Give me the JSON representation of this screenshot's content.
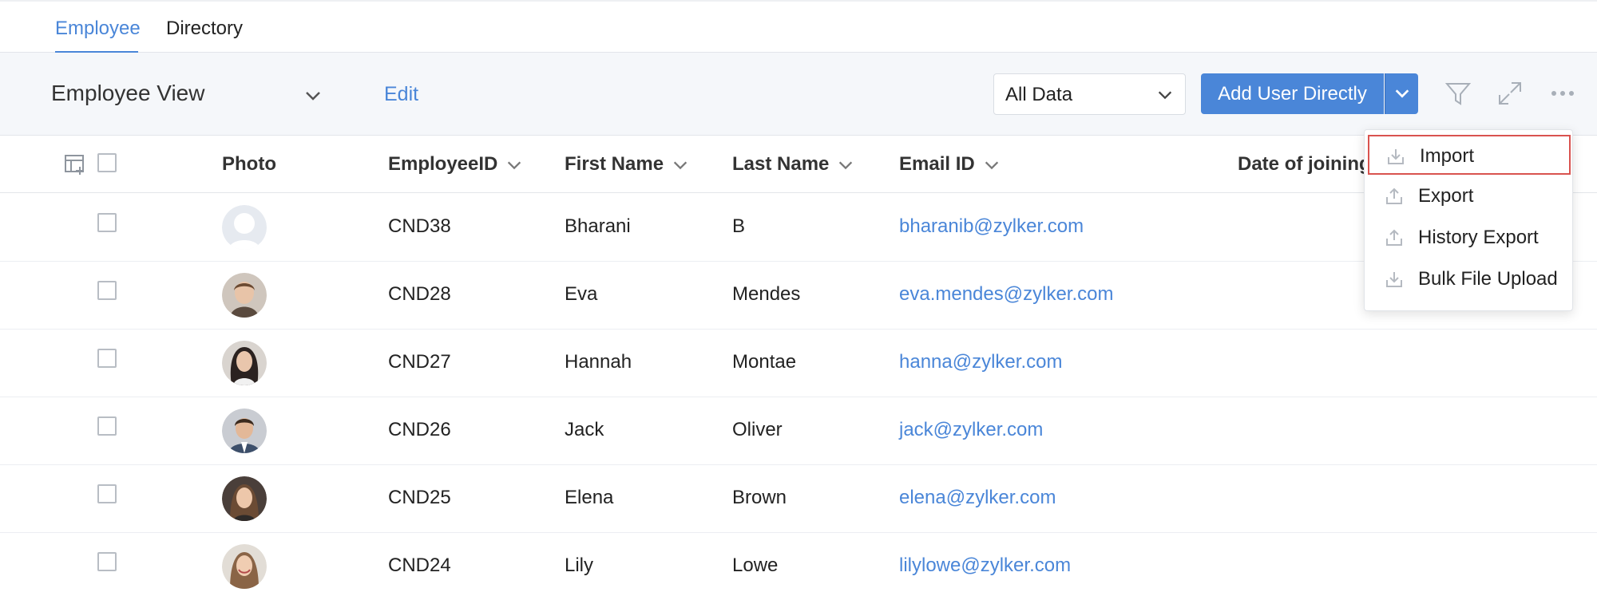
{
  "tabs": [
    {
      "label": "Employee",
      "active": true
    },
    {
      "label": "Directory",
      "active": false
    }
  ],
  "toolbar": {
    "view_title": "Employee View",
    "edit_label": "Edit",
    "filter_select_value": "All Data",
    "add_button_label": "Add User Directly"
  },
  "table": {
    "columns": [
      "Photo",
      "EmployeeID",
      "First Name",
      "Last Name",
      "Email ID",
      "Date of joining"
    ],
    "rows": [
      {
        "employee_id": "CND38",
        "first_name": "Bharani",
        "last_name": "B",
        "email": "bharanib@zylker.com",
        "avatar": "placeholder-avatar"
      },
      {
        "employee_id": "CND28",
        "first_name": "Eva",
        "last_name": "Mendes",
        "email": "eva.mendes@zylker.com",
        "avatar": "photo"
      },
      {
        "employee_id": "CND27",
        "first_name": "Hannah",
        "last_name": "Montae",
        "email": "hanna@zylker.com",
        "avatar": "photo"
      },
      {
        "employee_id": "CND26",
        "first_name": "Jack",
        "last_name": "Oliver",
        "email": "jack@zylker.com",
        "avatar": "photo"
      },
      {
        "employee_id": "CND25",
        "first_name": "Elena",
        "last_name": "Brown",
        "email": "elena@zylker.com",
        "avatar": "photo"
      },
      {
        "employee_id": "CND24",
        "first_name": "Lily",
        "last_name": "Lowe",
        "email": "lilylowe@zylker.com",
        "avatar": "photo"
      }
    ]
  },
  "more_menu": {
    "items": [
      {
        "label": "Import",
        "icon": "download-icon",
        "highlighted": true
      },
      {
        "label": "Export",
        "icon": "upload-icon",
        "highlighted": false
      },
      {
        "label": "History Export",
        "icon": "upload-icon",
        "highlighted": false
      },
      {
        "label": "Bulk File Upload",
        "icon": "download-icon",
        "highlighted": false
      }
    ]
  },
  "colors": {
    "accent": "#4a86d8",
    "toolbar_bg": "#f5f7fa",
    "highlight_border": "#d9534f"
  }
}
